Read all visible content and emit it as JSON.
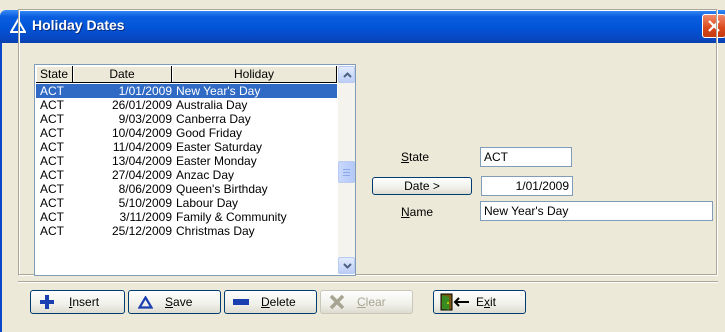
{
  "window": {
    "title": "Holiday Dates"
  },
  "list": {
    "columns": [
      "State",
      "Date",
      "Holiday"
    ],
    "rows": [
      {
        "state": "ACT",
        "date": "1/01/2009",
        "holiday": "New Year's Day"
      },
      {
        "state": "ACT",
        "date": "26/01/2009",
        "holiday": "Australia Day"
      },
      {
        "state": "ACT",
        "date": "9/03/2009",
        "holiday": "Canberra Day"
      },
      {
        "state": "ACT",
        "date": "10/04/2009",
        "holiday": "Good Friday"
      },
      {
        "state": "ACT",
        "date": "11/04/2009",
        "holiday": "Easter Saturday"
      },
      {
        "state": "ACT",
        "date": "13/04/2009",
        "holiday": "Easter Monday"
      },
      {
        "state": "ACT",
        "date": "27/04/2009",
        "holiday": "Anzac Day"
      },
      {
        "state": "ACT",
        "date": "8/06/2009",
        "holiday": "Queen's Birthday"
      },
      {
        "state": "ACT",
        "date": "5/10/2009",
        "holiday": "Labour Day"
      },
      {
        "state": "ACT",
        "date": "3/11/2009",
        "holiday": "Family & Community"
      },
      {
        "state": "ACT",
        "date": "25/12/2009",
        "holiday": "Christmas Day"
      }
    ],
    "selected_index": 0
  },
  "form": {
    "state_label_key": "S",
    "state_label_rest": "tate",
    "state_value": "ACT",
    "date_button_label": "Date >",
    "date_value": "1/01/2009",
    "name_label_key": "N",
    "name_label_rest": "ame",
    "name_value": "New Year's Day"
  },
  "buttons": {
    "insert_key": "I",
    "insert_rest": "nsert",
    "save_key": "S",
    "save_rest": "ave",
    "delete_key": "D",
    "delete_rest": "elete",
    "clear_key": "C",
    "clear_rest": "lear",
    "exit_pre": "E",
    "exit_key": "x",
    "exit_rest": "it"
  },
  "colors": {
    "titlebar": "#0254d6",
    "selection": "#316ac5",
    "insert_icon": "#1a3fb0",
    "close_button": "#d9471b"
  },
  "icons": {
    "title": "triangle-icon",
    "close": "close-icon",
    "insert": "plus-icon",
    "save": "triangle-icon",
    "delete": "minus-icon",
    "clear": "x-icon",
    "exit": "door-exit-icon"
  }
}
